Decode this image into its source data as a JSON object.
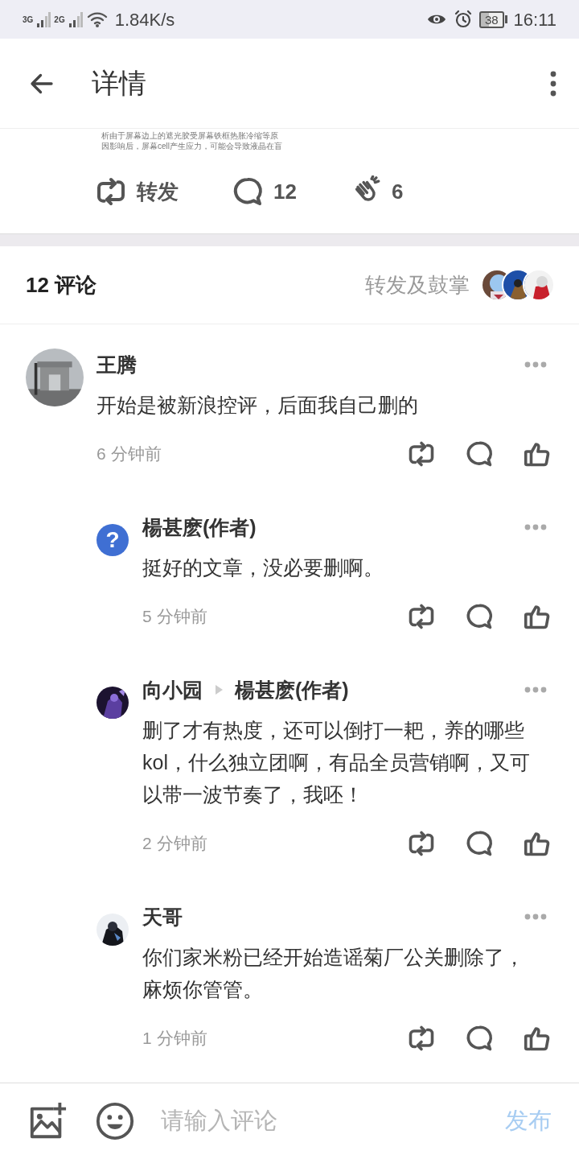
{
  "status_bar": {
    "signal_labels": [
      "3G",
      "2G"
    ],
    "network_speed": "1.84K/s",
    "battery": "38",
    "time": "16:11"
  },
  "header": {
    "title": "详情"
  },
  "post": {
    "excerpt_lines": [
      "析由于屏幕边上的遮光胶受屏幕铁框热胀冷缩等原",
      "因影响后，屏幕cell产生应力，可能会导致液晶在盲"
    ],
    "actions": [
      {
        "kind": "repost",
        "label": "转发"
      },
      {
        "kind": "comment",
        "label": "12"
      },
      {
        "kind": "clap",
        "label": "6"
      }
    ]
  },
  "comments_header": {
    "count_label": "12 评论",
    "reactions_label": "转发及鼓掌"
  },
  "comments": [
    {
      "author": "王腾",
      "text": "开始是被新浪控评，后面我自己删的",
      "time": "6 分钟前",
      "children": [
        {
          "author": "楊甚麽(作者)",
          "avatar": {
            "kind": "glyph",
            "glyph": "?"
          },
          "text": "挺好的文章，没必要删啊。",
          "time": "5 分钟前"
        },
        {
          "author": "向小园",
          "reply_to": "楊甚麽(作者)",
          "text": "删了才有热度，还可以倒打一耙，养的哪些kol，什么独立团啊，有品全员营销啊，又可以带一波节奏了，我呸！",
          "time": "2 分钟前"
        },
        {
          "author": "天哥",
          "text": "你们家米粉已经开始造谣菊厂公关删除了，麻烦你管管。",
          "time": "1 分钟前"
        }
      ]
    }
  ],
  "composer": {
    "placeholder": "请输入评论",
    "submit": "发布",
    "submit_disabled": true
  }
}
